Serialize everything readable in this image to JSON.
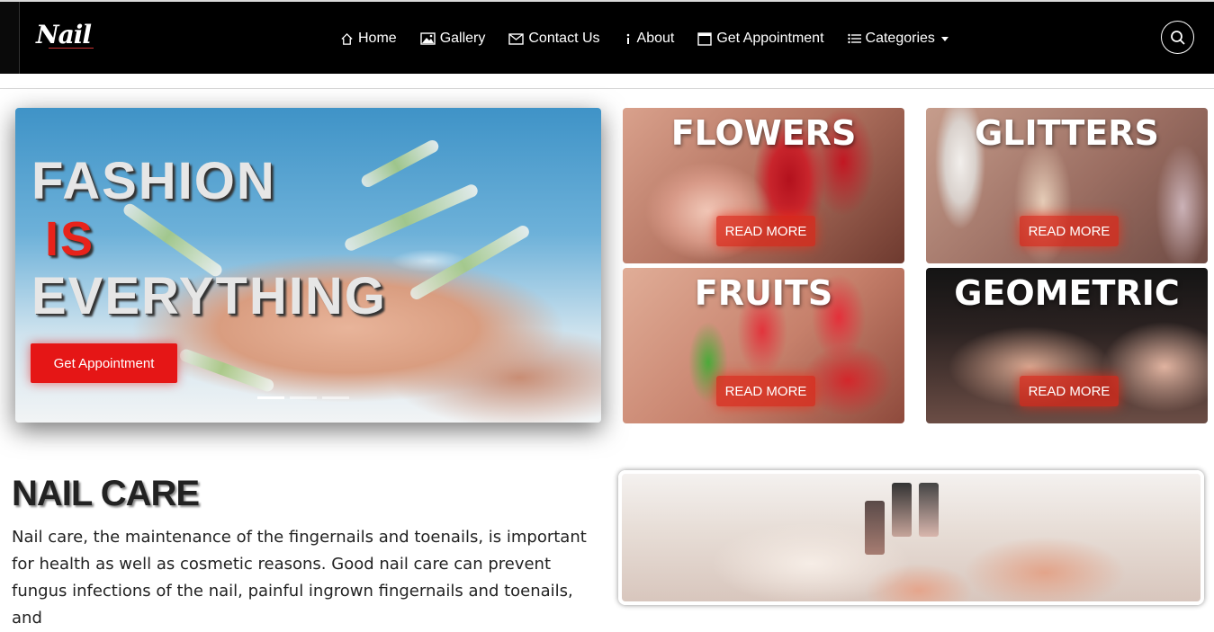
{
  "brand": {
    "logo_text": "Nail"
  },
  "nav": {
    "items": [
      {
        "label": "Home",
        "icon": "home-icon"
      },
      {
        "label": "Gallery",
        "icon": "image-icon"
      },
      {
        "label": "Contact Us",
        "icon": "envelope-icon"
      },
      {
        "label": "About",
        "icon": "info-icon"
      },
      {
        "label": "Get Appointment",
        "icon": "calendar-icon"
      },
      {
        "label": "Categories",
        "icon": "list-icon"
      }
    ],
    "search_icon": "search-icon"
  },
  "hero": {
    "line1": "FASHION",
    "line2": "IS",
    "line3": "EVERYTHING",
    "button": "Get Appointment",
    "slides": 3,
    "active_slide": 1
  },
  "categories": [
    {
      "title": "FLOWERS",
      "button": "READ MORE"
    },
    {
      "title": "GLITTERS",
      "button": "READ MORE"
    },
    {
      "title": "FRUITS",
      "button": "READ MORE"
    },
    {
      "title": "GEOMETRIC",
      "button": "READ MORE"
    }
  ],
  "nail_care": {
    "title": "NAIL CARE",
    "text": "Nail care, the maintenance of the fingernails and toenails, is important for health as well as cosmetic reasons. Good nail care can prevent fungus infections of the nail, painful ingrown fingernails and toenails, and"
  },
  "colors": {
    "navbar_bg": "#000000",
    "accent_red": "#e51616",
    "text_dark": "#222222"
  }
}
